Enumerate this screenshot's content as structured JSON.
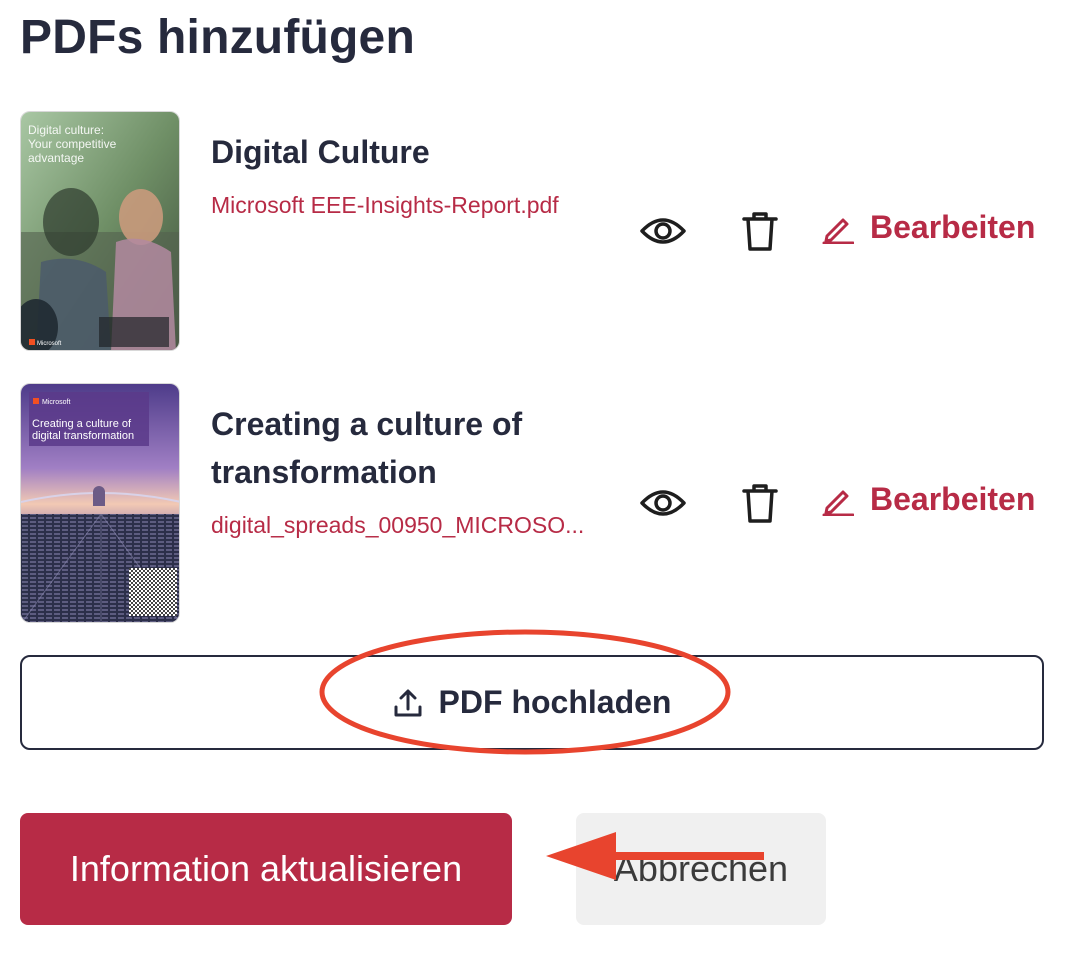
{
  "section": {
    "title": "PDFs hinzufügen"
  },
  "pdfs": [
    {
      "title": "Digital Culture",
      "file": "Microsoft EEE-Insights-Report.pdf",
      "cover_heading": "Digital culture:\nYour competitive\nadvantage",
      "cover_brand": "Microsoft",
      "view_icon": "eye-icon",
      "delete_icon": "trash-icon",
      "edit_icon": "pencil-icon",
      "edit_label": "Bearbeiten"
    },
    {
      "title": "Creating a culture of transformation",
      "file": "digital_spreads_00950_MICROSO...",
      "cover_heading": "Creating a culture of\ndigital transformation",
      "cover_brand": "Microsoft",
      "view_icon": "eye-icon",
      "delete_icon": "trash-icon",
      "edit_icon": "pencil-icon",
      "edit_label": "Bearbeiten"
    }
  ],
  "upload": {
    "label": "PDF hochladen",
    "icon": "upload-icon"
  },
  "actions": {
    "primary_label": "Information aktualisieren",
    "secondary_label": "Abbrechen"
  },
  "colors": {
    "accent": "#b72b46",
    "text": "#262a3d",
    "annotation": "#e8442e",
    "secondary_bg": "#f0f0f0"
  }
}
